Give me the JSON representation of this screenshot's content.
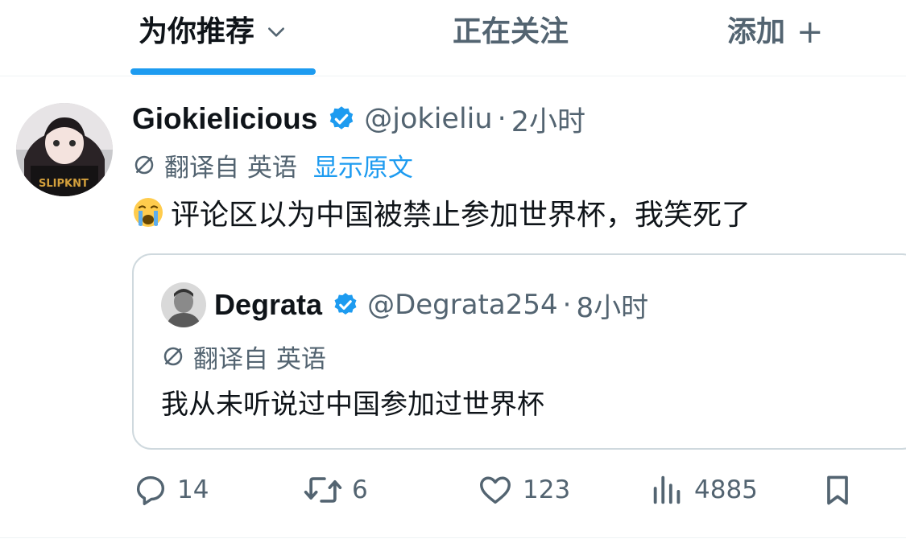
{
  "tabs": [
    {
      "label": "为你推荐"
    },
    {
      "label": "正在关注"
    },
    {
      "label": "添加"
    }
  ],
  "tab_add_symbol": "+",
  "tweet": {
    "display_name": "Giokielicious",
    "handle": "@jokieliu",
    "separator": "·",
    "time": "2小时",
    "translated_from": "翻译自 英语",
    "show_original": "显示原文",
    "text": "评论区以为中国被禁止参加世界杯，我笑死了",
    "emoji": "crying-face"
  },
  "quote": {
    "display_name": "Degrata",
    "handle": "@Degrata254",
    "separator": "·",
    "time": "8小时",
    "translated_from": "翻译自 英语",
    "text": "我从未听说过中国参加过世界杯"
  },
  "actions": {
    "replies": "14",
    "retweets": "6",
    "likes": "123",
    "views": "4885"
  },
  "colors": {
    "accent": "#1d9bf0",
    "text": "#0f1419",
    "muted": "#536471",
    "border": "#cfd9de"
  }
}
